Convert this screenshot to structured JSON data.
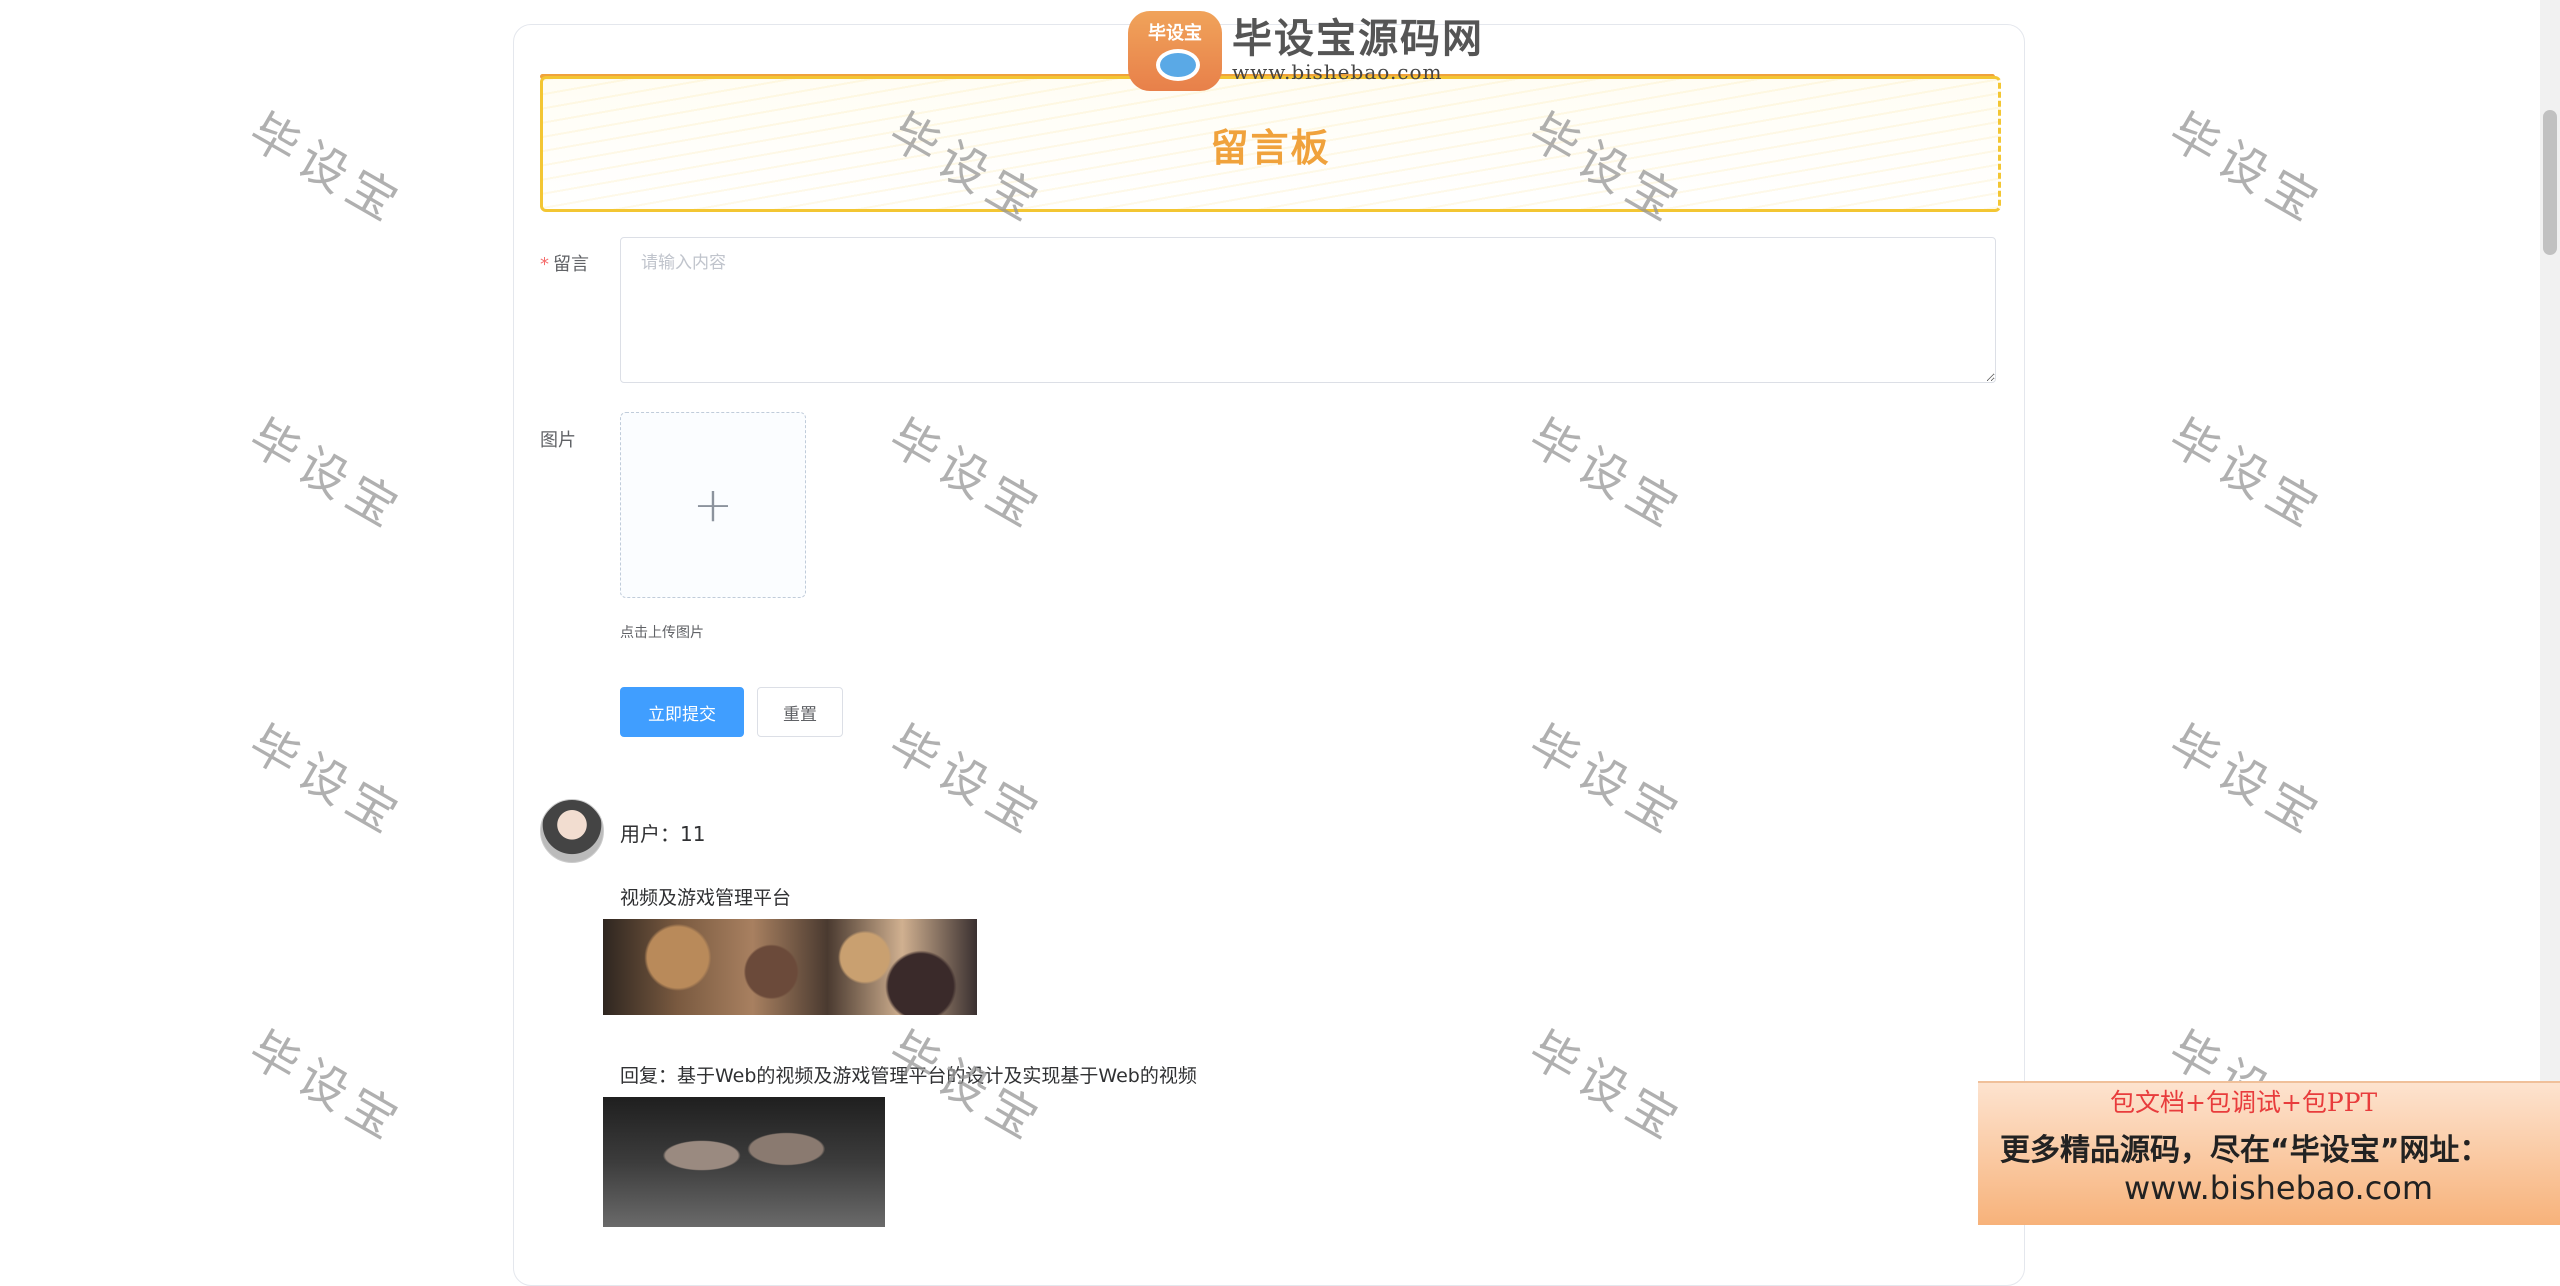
{
  "header": {
    "logo_badge_text": "毕设宝",
    "logo_name": "毕设宝源码网",
    "logo_url": "www.bishebao.com"
  },
  "banner": {
    "title": "留言板"
  },
  "form": {
    "required_mark": "*",
    "message_label": "留言",
    "message_placeholder": "请输入内容",
    "image_label": "图片",
    "upload_icon": "plus-icon",
    "upload_tip": "点击上传图片",
    "submit_label": "立即提交",
    "reset_label": "重置"
  },
  "comments": [
    {
      "user_text": "用户：11",
      "content": "视频及游戏管理平台",
      "reply": "回复：基于Web的视频及游戏管理平台的设计及实现基于Web的视频"
    }
  ],
  "watermark": "毕设宝",
  "ad": {
    "line1": "包文档+包调试+包PPT",
    "line2": "更多精品源码，尽在“毕设宝”网址：",
    "line3": "www.bishebao.com"
  }
}
